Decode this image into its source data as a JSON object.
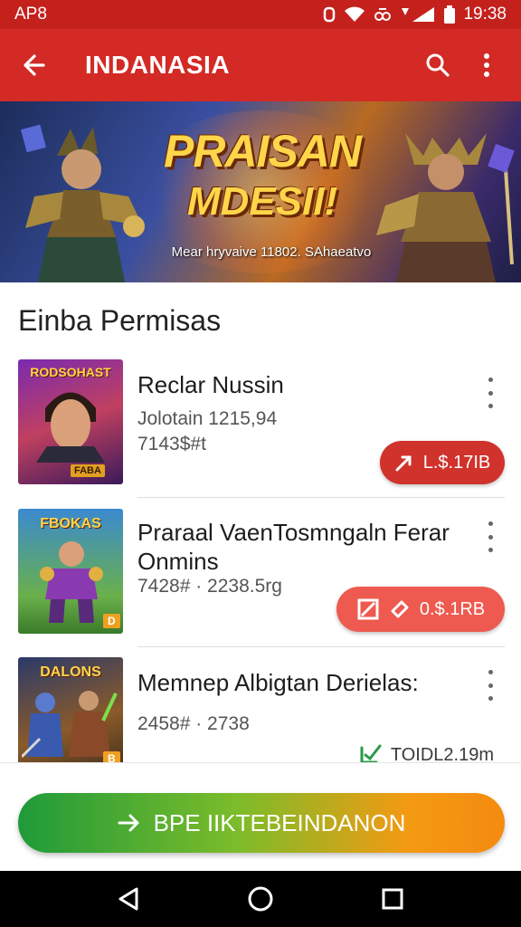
{
  "status_bar": {
    "carrier": "AP8",
    "time": "19:38"
  },
  "app_bar": {
    "title": "INDANASIA"
  },
  "banner": {
    "title_line1": "PRAISAN",
    "title_line2": "MDESII!",
    "subtitle": "Mear hryvaive 11802. SAhaeatvo"
  },
  "section": {
    "title": "Einba Permisas"
  },
  "items": [
    {
      "name": "Reclar Nussin",
      "meta1": "Jolotain 1215,94",
      "meta2": "7143$#t",
      "price": "L.$.17IB",
      "thumb_label": "RODSOHAST",
      "thumb_badge": "FABA"
    },
    {
      "name": "Praraal VaenTosmngaln Ferar Onmins",
      "meta1": "7428# · 2238.5rg",
      "price": "0.$.1RB",
      "thumb_label": "FBOKAS",
      "thumb_badge": "D"
    },
    {
      "name": "Memnep Albigtan Derielas:",
      "meta1": "2458# · 2738",
      "price": "TOIDL2.19m",
      "thumb_label": "DALONS",
      "thumb_badge": "B"
    }
  ],
  "cta": {
    "label": "BPE IIKTEBEINDANON"
  },
  "colors": {
    "primary": "#d32a25",
    "price_red": "#d0322c",
    "price_coral": "#ee5a4f",
    "cta_green": "#1f9a3a",
    "cta_orange": "#f58a10"
  }
}
